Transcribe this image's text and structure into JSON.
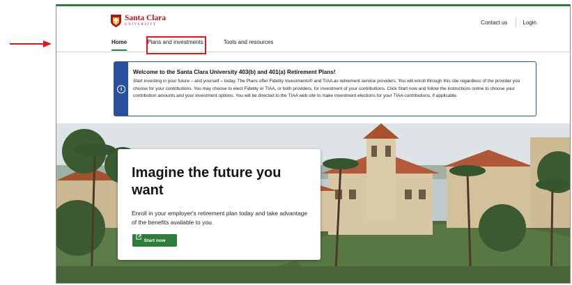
{
  "brand": {
    "name": "Santa Clara",
    "subtitle": "UNIVERSITY",
    "color": "#a4191f"
  },
  "header": {
    "contact_label": "Contact us",
    "login_label": "Login"
  },
  "nav": {
    "items": [
      {
        "label": "Home",
        "active": true
      },
      {
        "label": "Plans and investments",
        "active": false
      },
      {
        "label": "Tools and resources",
        "active": false
      }
    ]
  },
  "banner": {
    "icon": "info-icon",
    "title": "Welcome to the Santa Clara University 403(b) and 401(a) Retirement Plans!",
    "body": "Start investing in your future – and yourself – today. The Plans offer Fidelity Investments® and TIAA as retirement service providers. You will enroll through this site regardless of the provider you choose for your contributions. You may choose to elect Fidelity or TIAA, or both providers, for investment of your contributions. Click Start now and follow the instructions online to choose your contribution amounts and your investment options. You will be directed to the TIAA web site to make investment elections for your TIAA contributions, if applicable."
  },
  "hero": {
    "title": "Imagine the future you want",
    "subtitle": "Enroll in your employer's retirement plan today and take advantage of the benefits available to you.",
    "button_label": "Start now",
    "button_icon": "external-link-icon"
  },
  "colors": {
    "accent_green": "#2f7d3b",
    "banner_blue": "#2c50a0",
    "annotation_red": "#e0141b"
  }
}
